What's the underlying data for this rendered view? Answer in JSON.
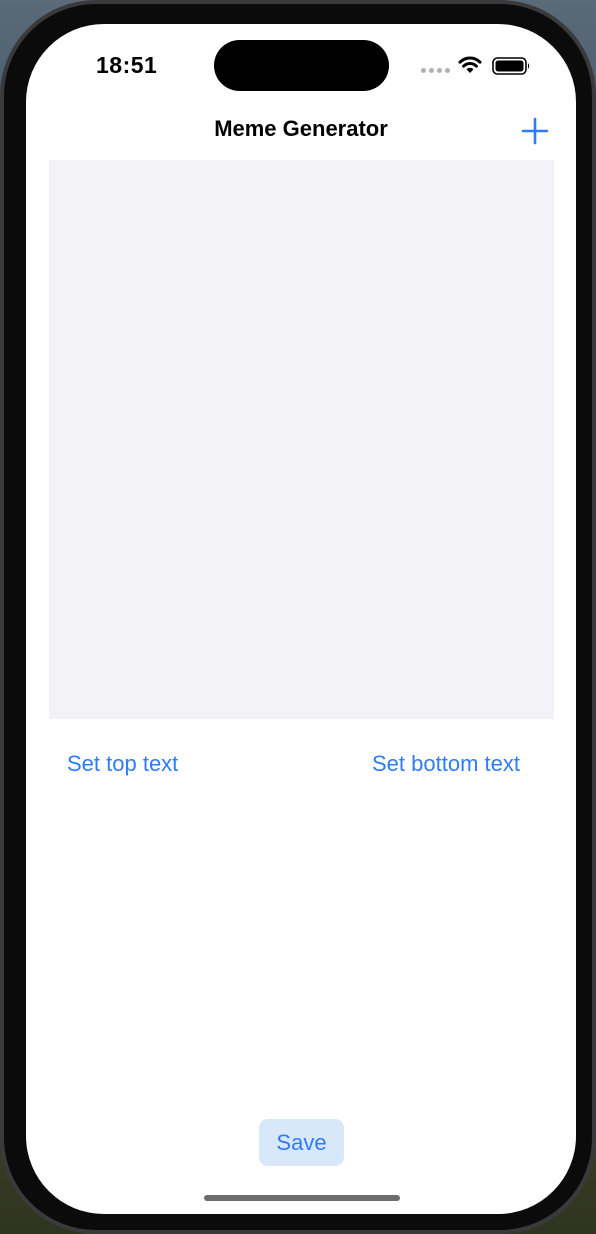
{
  "status_bar": {
    "time": "18:51",
    "icons": [
      "cellular-signal-icon",
      "wifi-icon",
      "battery-icon"
    ]
  },
  "nav_bar": {
    "title": "Meme Generator",
    "add_icon": "plus-icon"
  },
  "actions": {
    "top_text_label": "Set top text",
    "bottom_text_label": "Set bottom text",
    "save_label": "Save"
  },
  "colors": {
    "accent": "#2f7cf6",
    "image_placeholder_bg": "#f2f2f7",
    "save_button_bg": "#d9e7fb"
  }
}
